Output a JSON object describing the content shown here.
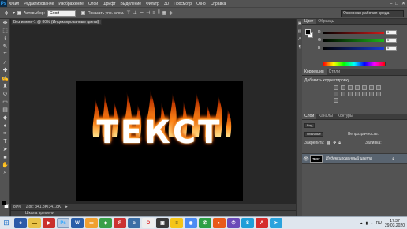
{
  "menubar": {
    "logo": "Ps",
    "items": [
      "Файл",
      "Редактирование",
      "Изображение",
      "Слои",
      "Шрифт",
      "Выделение",
      "Фильтр",
      "3D",
      "Просмотр",
      "Окно",
      "Справка"
    ],
    "window_controls": [
      "–",
      "□",
      "✕"
    ]
  },
  "options_bar": {
    "autoselect_label": "Автовыбор:",
    "autoselect_value": "Слой",
    "show_controls_label": "Показать упр. элем.",
    "workspace": "Основная рабочая среда"
  },
  "document": {
    "tab_title": "Без имени-1 @ 80% (Индексированные цвета)",
    "canvas_text": "ТЕКСТ"
  },
  "status": {
    "zoom": "80%",
    "doc_info": "Док: 341,8K/341,8K",
    "timeline_label": "Шкала времени"
  },
  "color_panel": {
    "tabs": [
      "Цвет",
      "Образцы"
    ],
    "rows": [
      {
        "label": "R",
        "value": "0",
        "gradient": "#d11a1a"
      },
      {
        "label": "G",
        "value": "0",
        "gradient": "#1ab51a"
      },
      {
        "label": "B",
        "value": "0",
        "gradient": "#1a3ad1"
      }
    ]
  },
  "adjustments_panel": {
    "tabs": [
      "Коррекция",
      "Стили"
    ],
    "title": "Добавить корректировку"
  },
  "layers_panel": {
    "tabs": [
      "Слои",
      "Каналы",
      "Контуры"
    ],
    "kind_filter": "Вид",
    "blend_mode": "Обычные",
    "opacity_label": "Непрозрачность:",
    "lock_label": "Закрепить:",
    "fill_label": "Заливка:",
    "layer_name": "Индексированный цвета",
    "thumb_text": "ТЕКСТ"
  },
  "taskbar": {
    "time": "17:37",
    "date": "29.03.2020",
    "language": "RU"
  },
  "colors": {
    "fire_core": "#ffffff",
    "fire_mid": "#ff8c1a",
    "fire_outer": "#b32d00"
  }
}
